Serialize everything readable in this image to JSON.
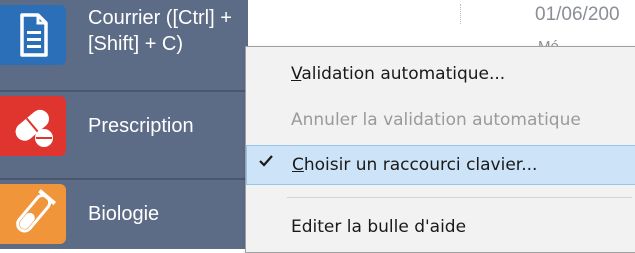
{
  "sidebar": {
    "items": [
      {
        "label_line1": "Courrier ([Ctrl] +",
        "label_line2": "[Shift] + C)",
        "icon": "document-icon",
        "color": "#2b6fb8"
      },
      {
        "label": "Prescription",
        "icon": "pill-icon",
        "color": "#e0342e"
      },
      {
        "label": "Biologie",
        "icon": "test-tube-icon",
        "color": "#f0953a"
      }
    ],
    "background": "#5c6b86"
  },
  "content": {
    "date": "01/06/200",
    "fragment": "Mé"
  },
  "context_menu": {
    "items": [
      {
        "label": "Validation automatique...",
        "accel": "V",
        "rest": "alidation automatique...",
        "enabled": true
      },
      {
        "label": "Annuler la validation automatique",
        "enabled": false
      },
      {
        "label": "Choisir un raccourci clavier...",
        "accel": "C",
        "rest": "hoisir un raccourci clavier...",
        "enabled": true,
        "checked": true,
        "highlighted": true
      },
      {
        "label": "Editer la bulle d'aide",
        "enabled": true
      }
    ],
    "highlight_color": "#cde3f7"
  }
}
